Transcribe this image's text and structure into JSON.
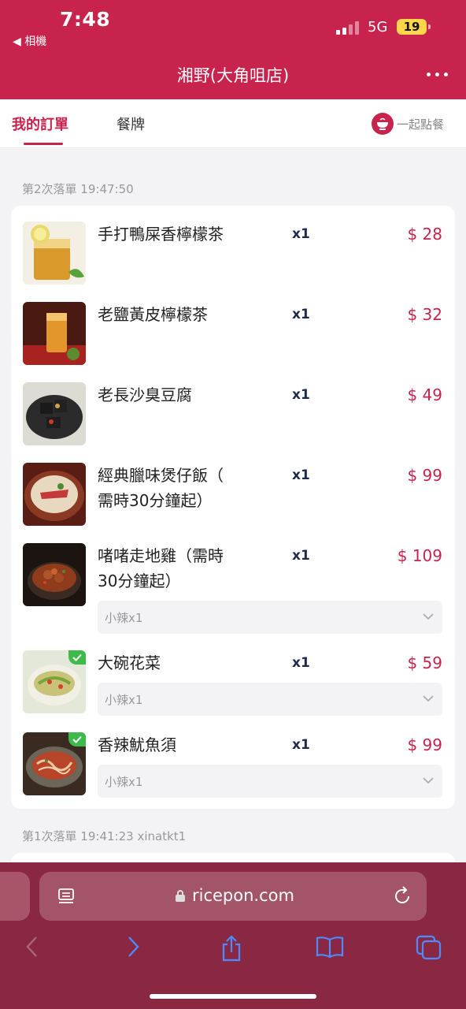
{
  "status": {
    "time": "7:48",
    "back_app": "◀ 相機",
    "network": "5G",
    "battery": "19"
  },
  "header": {
    "title": "湘野(大角咀店)"
  },
  "tabs": [
    {
      "label": "我的訂單",
      "active": true
    },
    {
      "label": "餐牌",
      "active": false
    }
  ],
  "together_label": "一起點餐",
  "orders": [
    {
      "header": "第2次落單 19:47:50",
      "items": [
        {
          "name": "手打鴨屎香檸檬茶",
          "qty": "x1",
          "price": "$ 28",
          "option": null,
          "checked": false
        },
        {
          "name": "老鹽黃皮檸檬茶",
          "qty": "x1",
          "price": "$ 32",
          "option": null,
          "checked": false
        },
        {
          "name": "老長沙臭豆腐",
          "qty": "x1",
          "price": "$ 49",
          "option": null,
          "checked": false
        },
        {
          "name": "經典臘味煲仔飯（需時30分鐘起）",
          "name_lines": [
            "經典臘味煲仔飯（",
            "需時30分鐘起）"
          ],
          "qty": "x1",
          "price": "$ 99",
          "option": null,
          "checked": false
        },
        {
          "name": "啫啫走地雞（需時30分鐘起）",
          "name_lines": [
            "啫啫走地雞（需時",
            "30分鐘起）"
          ],
          "qty": "x1",
          "price": "$ 109",
          "option": "小辣x1",
          "checked": false
        },
        {
          "name": "大碗花菜",
          "qty": "x1",
          "price": "$ 59",
          "option": "小辣x1",
          "checked": true
        },
        {
          "name": "香辣魷魚須",
          "qty": "x1",
          "price": "$ 99",
          "option": "小辣x1",
          "checked": true
        }
      ]
    },
    {
      "header": "第1次落單 19:41:23 xinatkt1",
      "items": []
    }
  ],
  "browser": {
    "url": "ricepon.com"
  },
  "colors": {
    "brand": "#c8234d",
    "price": "#c8234d",
    "browser_bar": "#8a2742"
  }
}
